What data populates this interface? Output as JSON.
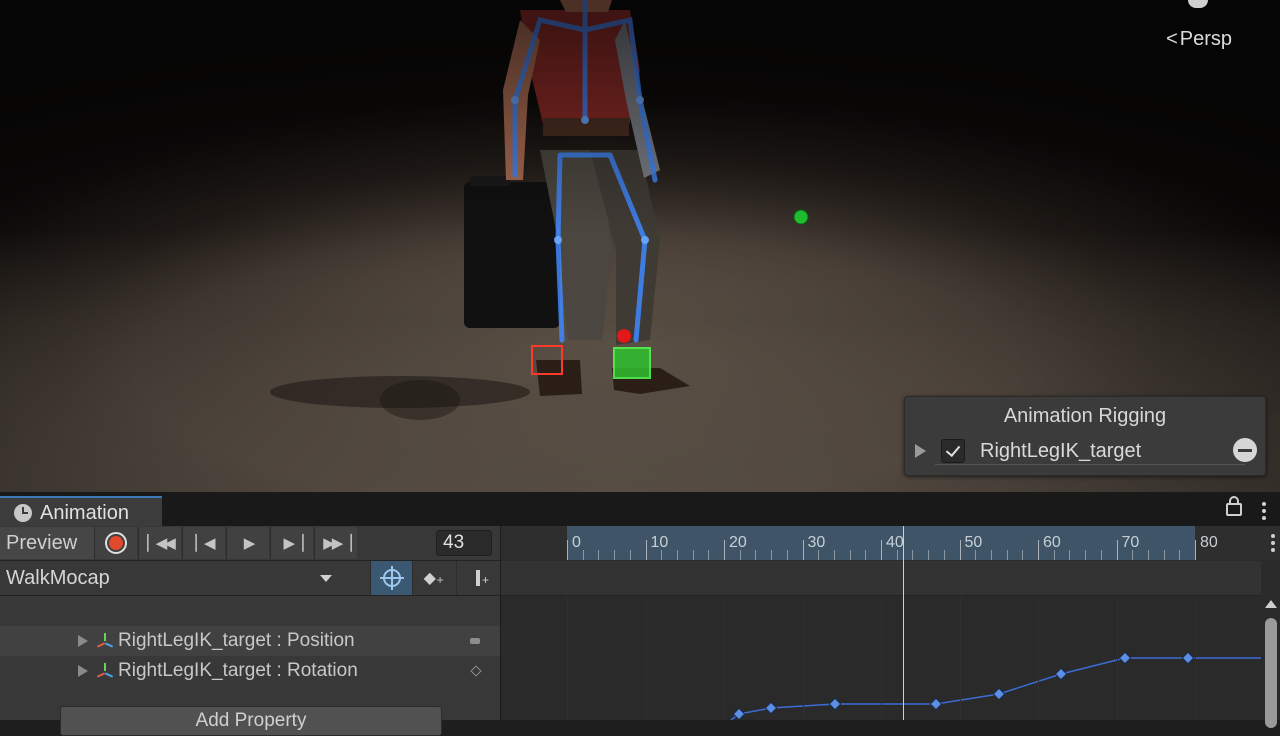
{
  "scene": {
    "camera_mode": "Persp"
  },
  "rigging_panel": {
    "title": "Animation Rigging",
    "target_label": "RightLegIK_target",
    "target_enabled": true
  },
  "animation_window": {
    "tab_label": "Animation",
    "preview_label": "Preview",
    "current_frame": "43",
    "clip_name": "WalkMocap",
    "properties": [
      {
        "label": "RightLegIK_target : Position"
      },
      {
        "label": "RightLegIK_target : Rotation"
      }
    ],
    "add_property_label": "Add Property",
    "ruler_labels": [
      "0",
      "10",
      "20",
      "30",
      "40",
      "50",
      "60",
      "70",
      "80"
    ]
  },
  "colors": {
    "accent": "#3a79bb",
    "record": "#e0492c",
    "curve": "#3d6cd6",
    "keyframe": "#5b8fe6"
  },
  "icons": [
    "persp-arrow-icon",
    "checkbox-icon",
    "remove-icon",
    "clock-icon",
    "lock-icon",
    "kebab-icon",
    "record-icon",
    "first-key-icon",
    "prev-key-icon",
    "play-icon",
    "next-key-icon",
    "last-key-icon",
    "filter-selected-icon",
    "add-keyframe-icon",
    "add-event-icon",
    "transform-axes-icon"
  ]
}
